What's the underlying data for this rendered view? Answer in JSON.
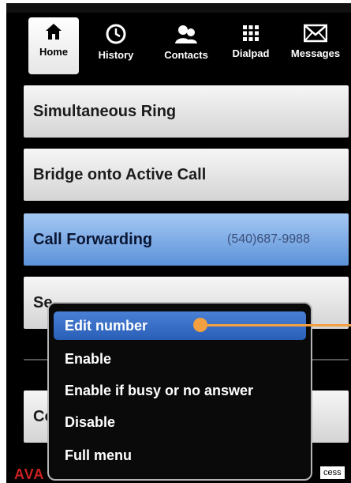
{
  "tabs": [
    {
      "label": "Home",
      "icon": "home-icon",
      "active": true
    },
    {
      "label": "History",
      "icon": "clock-icon",
      "active": false
    },
    {
      "label": "Contacts",
      "icon": "contacts-icon",
      "active": false
    },
    {
      "label": "Dialpad",
      "icon": "dialpad-icon",
      "active": false
    },
    {
      "label": "Messages",
      "icon": "envelope-icon",
      "active": false
    }
  ],
  "rows": {
    "simultaneous_ring": "Simultaneous Ring",
    "bridge": "Bridge onto Active Call",
    "call_forwarding": "Call Forwarding",
    "call_forwarding_value": "(540)687-9988",
    "send_calls_partial": "Se",
    "bottom_row_partial": "Co"
  },
  "popup_menu": {
    "items": [
      "Edit number",
      "Enable",
      "Enable if busy or no answer",
      "Disable",
      "Full menu"
    ],
    "highlighted_index": 0
  },
  "footer": {
    "brand_partial": "AVA",
    "access_partial": "cess"
  },
  "colors": {
    "selected_row": "#5c92d9",
    "menu_highlight": "#2a5fb8",
    "callout": "#f2a040",
    "brand": "#cc2020"
  }
}
